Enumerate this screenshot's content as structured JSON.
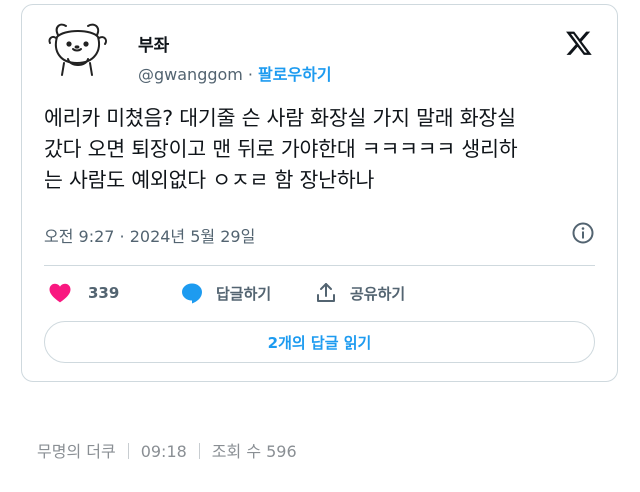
{
  "tweet": {
    "author_name": "부좌",
    "handle": "@gwanggom",
    "separator": "·",
    "follow_label": "팔로우하기",
    "text": "에리카 미쳤음? 대기줄 슨 사람 화장실 가지 말래 화장실\n갔다 오면 퇴장이고 맨 뒤로 가야한대 ㅋㅋㅋㅋㅋ 생리하\n는 사람도 예외없다 ㅇㅈㄹ 함 장난하나",
    "timestamp": "오전 9:27 · 2024년 5월 29일",
    "like_count": "339",
    "reply_label": "답글하기",
    "share_label": "공유하기",
    "read_replies_label": "2개의 답글 읽기"
  },
  "post_footer": {
    "author": "무명의 더쿠",
    "time": "09:18",
    "views": "조회 수 596"
  },
  "colors": {
    "accent": "#1d9bf0",
    "like": "#f91880",
    "muted_text": "#536471",
    "border": "#cfd9de"
  },
  "icons": [
    "bear-avatar",
    "x-logo-icon",
    "info-icon",
    "heart-icon",
    "reply-bubble-icon",
    "share-icon"
  ]
}
